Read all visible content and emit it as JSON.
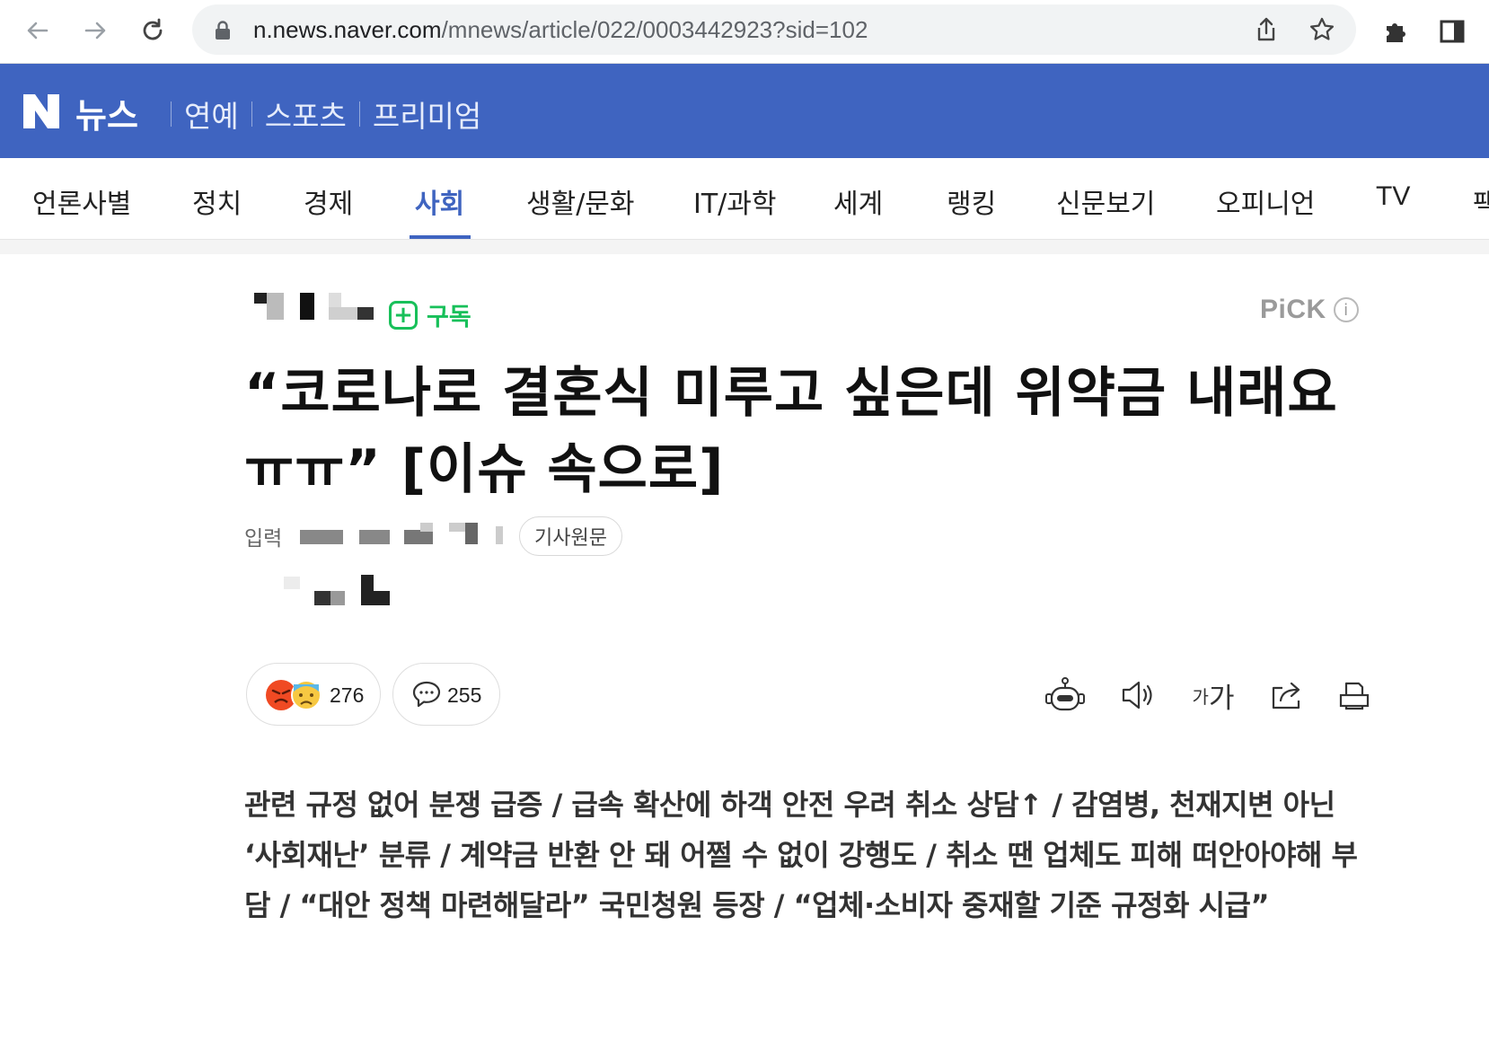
{
  "browser": {
    "url_host": "n.news.naver.com",
    "url_path": "/mnews/article/022/0003442923?sid=102"
  },
  "naver_header": {
    "logo": "N",
    "brand": "뉴스",
    "links": [
      "연예",
      "스포츠",
      "프리미엄"
    ]
  },
  "tabs": [
    {
      "label": "언론사별"
    },
    {
      "label": "정치"
    },
    {
      "label": "경제"
    },
    {
      "label": "사회"
    },
    {
      "label": "생활/문화"
    },
    {
      "label": "IT/과학"
    },
    {
      "label": "세계"
    },
    {
      "label": "랭킹"
    },
    {
      "label": "신문보기"
    },
    {
      "label": "오피니언"
    },
    {
      "label": "TV"
    },
    {
      "label": "팩"
    }
  ],
  "active_tab": "사회",
  "article": {
    "subscribe_label": "구독",
    "pick_label": "PiCK",
    "pick_info": "i",
    "headline_line1": "“코로나로 결혼식 미루고 싶은데 위약금 내래요",
    "headline_line2": "ㅠㅠ” [이슈 속으로]",
    "input_label": "입력",
    "original_button": "기사원문",
    "reaction_count": "276",
    "comment_count": "255",
    "font_tool_small": "가",
    "font_tool_large": "가",
    "summary": "관련 규정 없어 분쟁 급증 / 급속 확산에 하객 안전 우려 취소 상담↑ / 감염병, 천재지변 아닌 ‘사회재난’ 분류 / 계약금 반환 안 돼 어쩔 수 없이 강행도 / 취소 땐 업체도 피해 떠안아야해 부담 / “대안 정책 마련해달라” 국민청원 등장 / “업체·소비자 중재할 기준 규정화 시급”"
  },
  "colors": {
    "naver_blue": "#3f64c0",
    "subscribe_green": "#18c05a",
    "angry_red": "#f04a23"
  },
  "icons": [
    "back-arrow-icon",
    "forward-arrow-icon",
    "reload-icon",
    "lock-icon",
    "share-icon",
    "star-icon",
    "extension-icon",
    "sidepanel-icon",
    "summary-bot-icon",
    "speaker-icon",
    "share-out-icon",
    "print-icon",
    "comment-icon",
    "angry-emoji-icon",
    "sad-emoji-icon"
  ]
}
